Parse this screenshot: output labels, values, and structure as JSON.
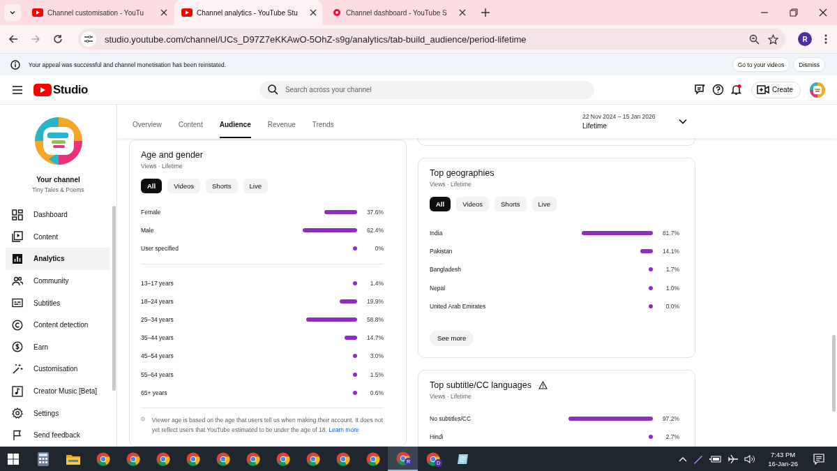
{
  "browser": {
    "tabs": [
      {
        "title": "Channel customisation - YouTu",
        "kind": "youtube",
        "selected": false
      },
      {
        "title": "Channel analytics - YouTube Stu",
        "kind": "youtube",
        "selected": true
      },
      {
        "title": "Channel dashboard - YouTube S",
        "kind": "studio",
        "selected": false
      }
    ],
    "url": "studio.youtube.com/channel/UCs_D97Z7eKKAwO-5OhZ-s9g/analytics/tab-build_audience/period-lifetime",
    "profile": "R"
  },
  "notice": {
    "text": "Your appeal was successful and channel monetisation has been reinstated.",
    "buttons": [
      "Go to your videos",
      "Dismiss"
    ]
  },
  "header": {
    "logo": "Studio",
    "search": {
      "placeholder": "Search across your channel"
    },
    "create": "Create"
  },
  "sidebar": {
    "channel_title": "Your channel",
    "channel_name": "Tiny Tales & Poems",
    "items": [
      {
        "label": "Dashboard",
        "kind": "dashboard",
        "selected": false
      },
      {
        "label": "Content",
        "kind": "content",
        "selected": false
      },
      {
        "label": "Analytics",
        "kind": "analytics",
        "selected": true
      },
      {
        "label": "Community",
        "kind": "community",
        "selected": false
      },
      {
        "label": "Subtitles",
        "kind": "subtitles",
        "selected": false
      },
      {
        "label": "Content detection",
        "kind": "detection",
        "selected": false
      },
      {
        "label": "Earn",
        "kind": "earn",
        "selected": false
      },
      {
        "label": "Customisation",
        "kind": "customisation",
        "selected": false
      },
      {
        "label": "Creator Music [Beta]",
        "kind": "music",
        "selected": false
      },
      {
        "label": "Settings",
        "kind": "settings",
        "selected": false
      },
      {
        "label": "Send feedback",
        "kind": "feedback",
        "selected": false
      }
    ]
  },
  "analytics": {
    "tabs": [
      {
        "label": "Overview",
        "selected": false
      },
      {
        "label": "Content",
        "selected": false
      },
      {
        "label": "Audience",
        "selected": true
      },
      {
        "label": "Revenue",
        "selected": false
      },
      {
        "label": "Trends",
        "selected": false
      }
    ],
    "date_range": {
      "range": "22 Nov 2024 – 15 Jan 2026",
      "period": "Lifetime"
    }
  },
  "age_gender": {
    "title": "Age and gender",
    "subtitle": "Views · Lifetime",
    "filters": [
      {
        "label": "All",
        "selected": true
      },
      {
        "label": "Videos",
        "selected": false
      },
      {
        "label": "Shorts",
        "selected": false
      },
      {
        "label": "Live",
        "selected": false
      }
    ],
    "gender": [
      {
        "label": "Female",
        "value": "37.6%",
        "level": 0.376
      },
      {
        "label": "Male",
        "value": "62.4%",
        "level": 0.624
      },
      {
        "label": "User specified",
        "value": "0%",
        "level": 0
      }
    ],
    "age": [
      {
        "label": "13–17 years",
        "value": "1.4%",
        "level": 0.014
      },
      {
        "label": "18–24 years",
        "value": "19.9%",
        "level": 0.199
      },
      {
        "label": "25–34 years",
        "value": "58.8%",
        "level": 0.588
      },
      {
        "label": "35–44 years",
        "value": "14.7%",
        "level": 0.147
      },
      {
        "label": "45–54 years",
        "value": "3.0%",
        "level": 0.03
      },
      {
        "label": "55–64 years",
        "value": "1.5%",
        "level": 0.015
      },
      {
        "label": "65+ years",
        "value": "0.6%",
        "level": 0.006
      }
    ],
    "note": {
      "text": "Viewer age is based on the age that users tell us when making their account. It does not yet reflect users that YouTube estimated to be under the age of 18.",
      "link": "Learn more"
    }
  },
  "geographies": {
    "title": "Top geographies",
    "subtitle": "Views · Lifetime",
    "filters": [
      {
        "label": "All",
        "selected": true
      },
      {
        "label": "Videos",
        "selected": false
      },
      {
        "label": "Shorts",
        "selected": false
      },
      {
        "label": "Live",
        "selected": false
      }
    ],
    "rows": [
      {
        "label": "India",
        "value": "81.7%",
        "level": 0.817
      },
      {
        "label": "Pakistan",
        "value": "14.1%",
        "level": 0.141
      },
      {
        "label": "Bangladesh",
        "value": "1.7%",
        "level": 0.017
      },
      {
        "label": "Nepal",
        "value": "1.0%",
        "level": 0.01
      },
      {
        "label": "United Arab Emirates",
        "value": "0.0%",
        "level": 0
      }
    ],
    "see_more": "See more"
  },
  "subtitles": {
    "title": "Top subtitle/CC languages",
    "warning": true,
    "subtitle": "Views · Lifetime",
    "rows": [
      {
        "label": "No subtitles/CC",
        "value": "97.2%",
        "level": 0.972
      },
      {
        "label": "Hindi",
        "value": "2.7%",
        "level": 0.027
      }
    ]
  },
  "taskbar": {
    "apps": [
      {
        "kind": "calculator",
        "selected": false
      },
      {
        "kind": "folder",
        "selected": false
      },
      {
        "kind": "browser",
        "selected": false
      },
      {
        "kind": "browser",
        "selected": false
      },
      {
        "kind": "browser",
        "selected": false
      },
      {
        "kind": "browser",
        "selected": false
      },
      {
        "kind": "browser",
        "selected": false
      },
      {
        "kind": "browser",
        "selected": false
      },
      {
        "kind": "browser",
        "selected": false
      },
      {
        "kind": "browser",
        "selected": false
      },
      {
        "kind": "browser",
        "selected": false
      },
      {
        "kind": "browser",
        "selected": false
      },
      {
        "kind": "browser",
        "badge": "R",
        "selected": true
      },
      {
        "kind": "browser",
        "badge": "D",
        "selected": false
      },
      {
        "kind": "notes",
        "selected": false
      }
    ],
    "time": "7:43 PM",
    "date": "16-Jan-26"
  }
}
